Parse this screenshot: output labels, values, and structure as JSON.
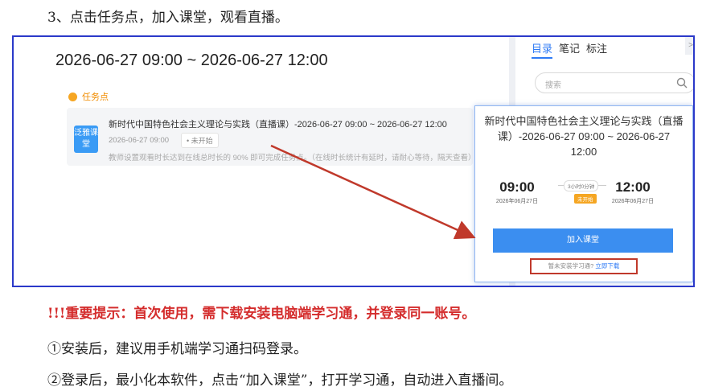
{
  "step_heading": "3、点击任务点，加入课堂，观看直播。",
  "live": {
    "time_range": "2026-06-27 09:00 ~ 2026-06-27 12:00",
    "task_section_label": "任务点",
    "task": {
      "badge": "泛雅课堂",
      "name": "新时代中国特色社会主义理论与实践（直播课）-2026-06-27 09:00 ~ 2026-06-27 12:00",
      "time": "2026-06-27 09:00",
      "status": "• 未开始",
      "hint": "教师设置观看时长达到在线总时长的 90% 即可完成任务点。（在线时长统计有延时，请耐心等待，隔天查看）"
    }
  },
  "side_panel": {
    "tabs": [
      "目录",
      "笔记",
      "标注"
    ],
    "toggle": ">",
    "search_placeholder": "搜索"
  },
  "popup": {
    "title": "新时代中国特色社会主义理论与实践（直播课）-2026-06-27 09:00 ~ 2026-06-27 12:00",
    "start_time": "09:00",
    "start_date": "2026年06月27日",
    "end_time": "12:00",
    "end_date": "2026年06月27日",
    "duration": "3小时0分钟",
    "status": "未开始",
    "join_label": "加入课堂",
    "download_prompt": "暂未安装学习通?",
    "download_link": "立即下载"
  },
  "notice": "!!!重要提示：首次使用，需下载安装电脑端学习通，并登录同一账号。",
  "note_1": "①安装后，建议用手机端学习通扫码登录。",
  "note_2": "②登录后，最小化本软件，点击“加入课堂”，打开学习通，自动进入直播间。",
  "colors": {
    "frame_border": "#2b39c9",
    "accent_blue": "#3b8ef0",
    "annotation_red": "#c0392b",
    "status_orange": "#f5a623"
  }
}
